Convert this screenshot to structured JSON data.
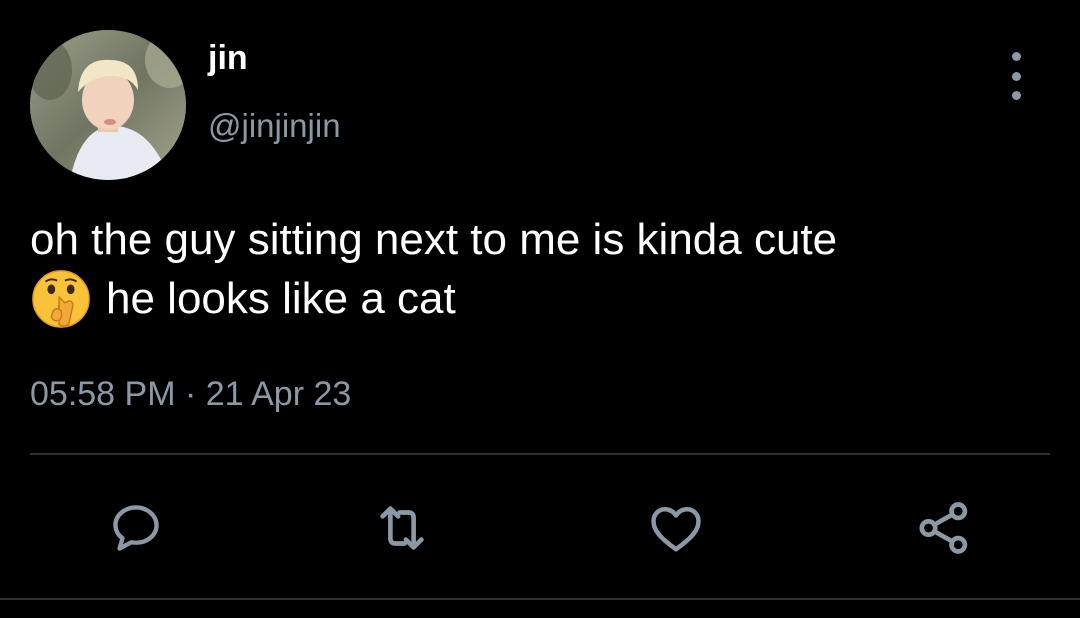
{
  "author": {
    "display_name": "jin",
    "handle": "@jinjinjin",
    "avatar_icon": "profile-photo"
  },
  "tweet": {
    "text_line1": "oh the guy sitting next to me is kinda cute",
    "emoji": "shushing-face-emoji",
    "text_line2": "he looks like a cat",
    "timestamp": "05:58 PM · 21 Apr 23"
  },
  "actions": {
    "reply": "reply-icon",
    "retweet": "retweet-icon",
    "like": "heart-icon",
    "share": "share-icon",
    "more": "more-vertical-icon"
  },
  "colors": {
    "background": "#000000",
    "text_primary": "#ffffff",
    "text_secondary": "#8b98a5",
    "divider": "#2f3336"
  }
}
